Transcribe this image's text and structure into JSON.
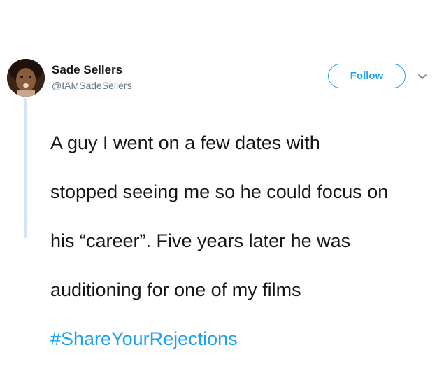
{
  "tweet": {
    "author": {
      "display_name": "Sade Sellers",
      "handle": "@IAMSadeSellers",
      "avatar_icon": "profile-photo"
    },
    "follow_label": "Follow",
    "menu_icon": "chevron-down-icon",
    "body_lines": [
      "A guy I went on a few dates with",
      "stopped seeing me so he could focus on",
      "his “career”. Five years later he was",
      "auditioning for one of my films"
    ],
    "hashtag": "#ShareYourRejections"
  },
  "colors": {
    "accent": "#1da1f2",
    "text_primary": "#14171a",
    "text_secondary": "#657786",
    "thread_line": "#d4e6f4"
  }
}
